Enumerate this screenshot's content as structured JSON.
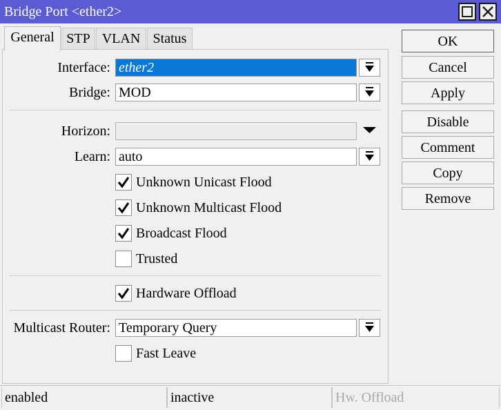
{
  "window": {
    "title": "Bridge Port <ether2>",
    "title_bar_color": "#5b5bd6",
    "controls": [
      "maximize-icon",
      "close-icon"
    ]
  },
  "tabs": [
    {
      "label": "General",
      "active": true
    },
    {
      "label": "STP",
      "active": false
    },
    {
      "label": "VLAN",
      "active": false
    },
    {
      "label": "Status",
      "active": false
    }
  ],
  "general": {
    "interface": {
      "label": "Interface:",
      "value": "ether2",
      "selected": true
    },
    "bridge": {
      "label": "Bridge:",
      "value": "MOD"
    },
    "horizon": {
      "label": "Horizon:",
      "value": ""
    },
    "learn": {
      "label": "Learn:",
      "value": "auto"
    },
    "checkboxes": [
      {
        "label": "Unknown Unicast Flood",
        "checked": true
      },
      {
        "label": "Unknown Multicast Flood",
        "checked": true
      },
      {
        "label": "Broadcast Flood",
        "checked": true
      },
      {
        "label": "Trusted",
        "checked": false
      }
    ],
    "hardware_offload": {
      "label": "Hardware Offload",
      "checked": true
    },
    "multicast_router": {
      "label": "Multicast Router:",
      "value": "Temporary Query"
    },
    "fast_leave": {
      "label": "Fast Leave",
      "checked": false
    }
  },
  "buttons": {
    "ok": "OK",
    "cancel": "Cancel",
    "apply": "Apply",
    "disable": "Disable",
    "comment": "Comment",
    "copy": "Copy",
    "remove": "Remove"
  },
  "status_bar": {
    "state": "enabled",
    "activity": "inactive",
    "hw_offload": "Hw. Offload"
  },
  "colors": {
    "selection": "#0a78d7",
    "accent": "#5b5bd6"
  }
}
